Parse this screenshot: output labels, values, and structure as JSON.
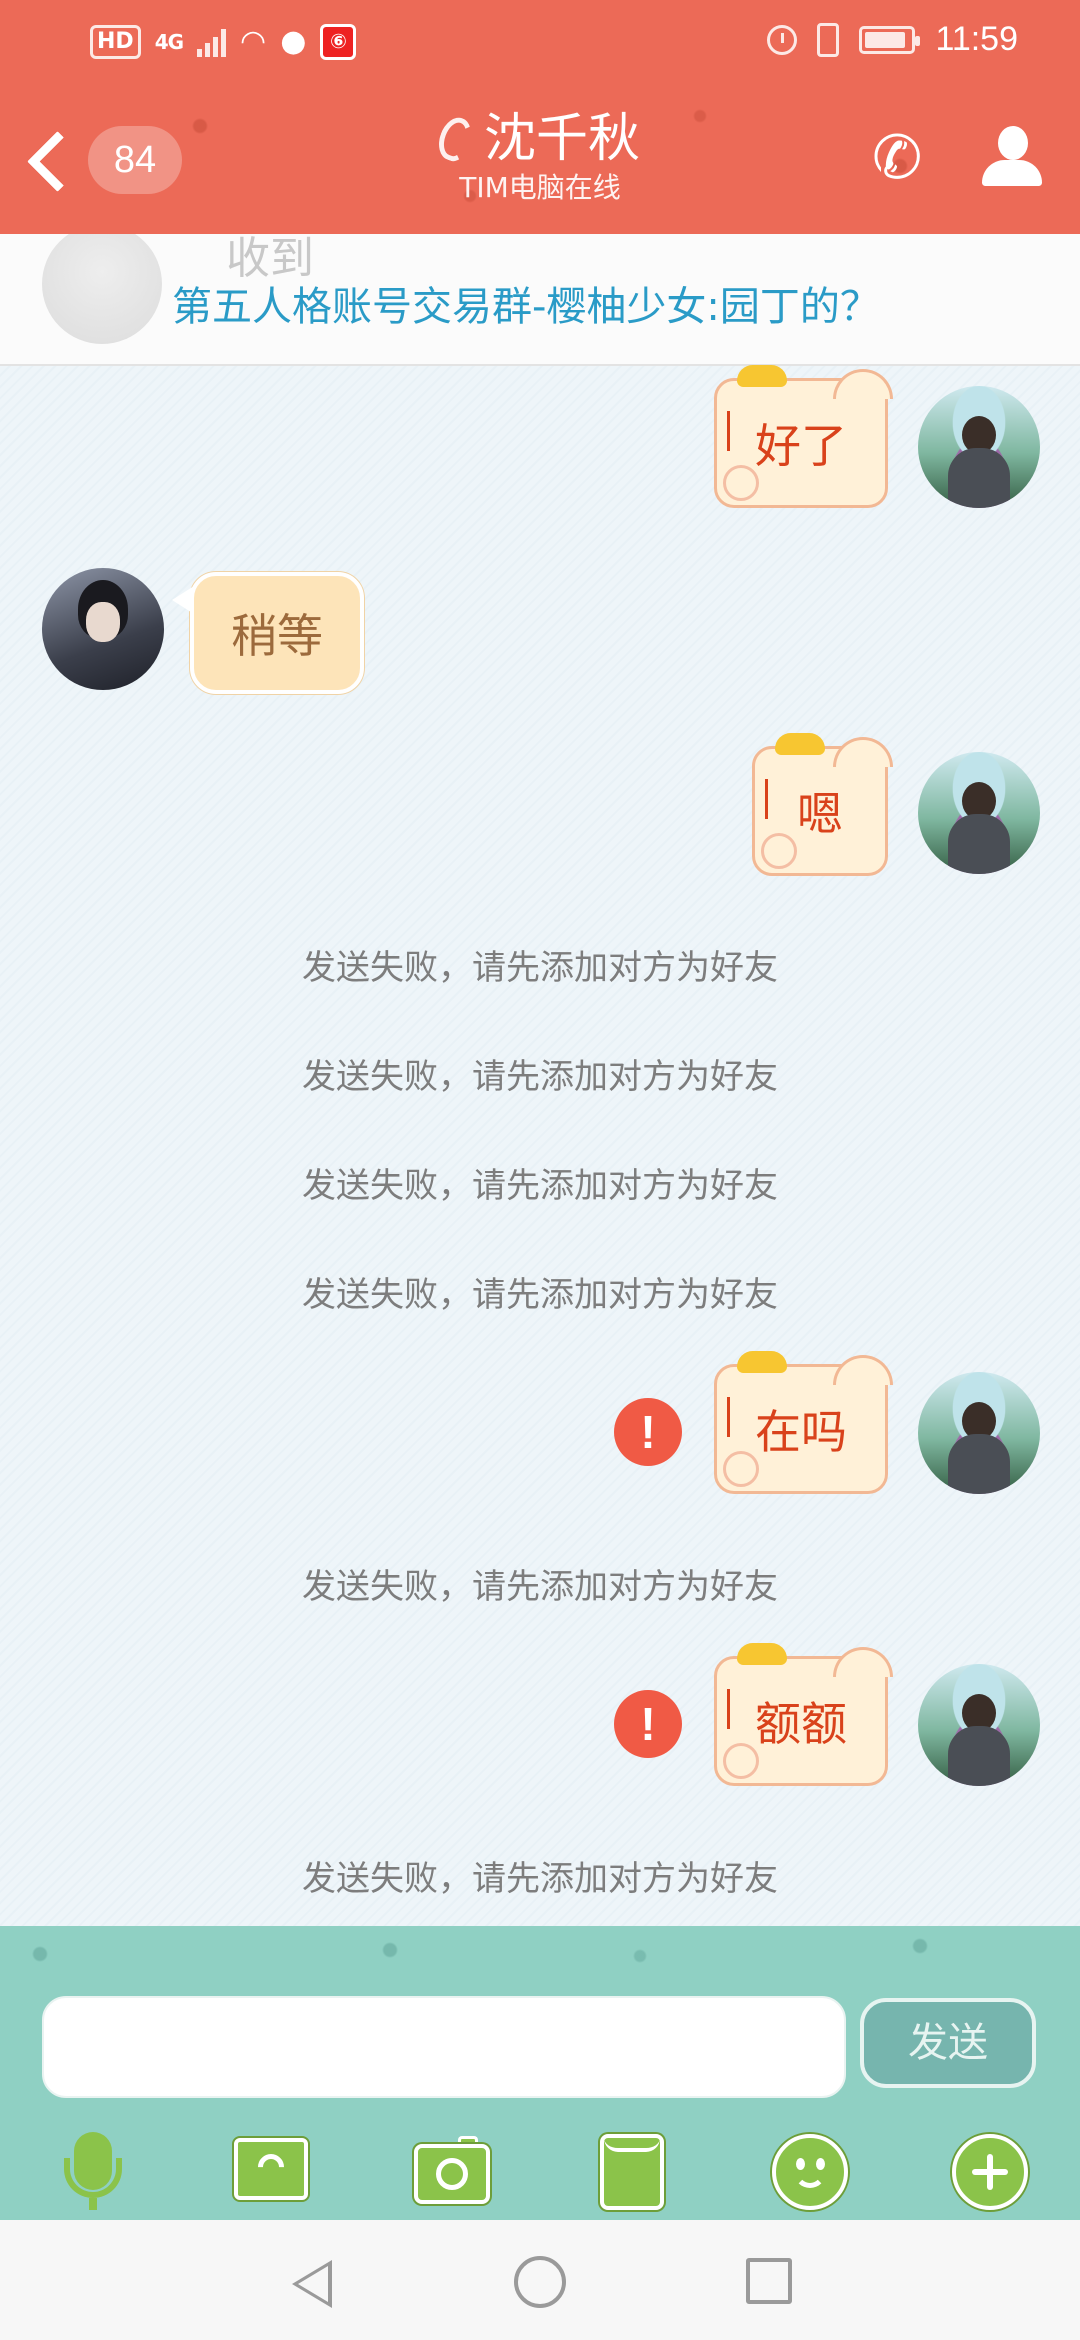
{
  "status_bar": {
    "hd_label": "HD",
    "network_label": "4G",
    "app_badge": "⑥",
    "time": "11:59",
    "battery_level": 0.9
  },
  "header": {
    "unread_count": "84",
    "title": "沈千秋",
    "subtitle": "TIM电脑在线",
    "icons": [
      "back-arrow-icon",
      "ear-icon",
      "phone-icon",
      "contact-icon"
    ]
  },
  "banner": {
    "ghost_text": "收到",
    "text": "第五人格账号交易群-樱柚少女:园丁的？"
  },
  "messages": [
    {
      "from": "me",
      "text": "好了",
      "failed": false
    },
    {
      "from": "other",
      "text": "稍等"
    },
    {
      "from": "me",
      "text": "嗯",
      "failed": false
    },
    {
      "from": "system",
      "text": "发送失败，请先添加对方为好友"
    },
    {
      "from": "system",
      "text": "发送失败，请先添加对方为好友"
    },
    {
      "from": "system",
      "text": "发送失败，请先添加对方为好友"
    },
    {
      "from": "system",
      "text": "发送失败，请先添加对方为好友"
    },
    {
      "from": "me",
      "text": "在吗",
      "failed": true
    },
    {
      "from": "system",
      "text": "发送失败，请先添加对方为好友"
    },
    {
      "from": "me",
      "text": "额额",
      "failed": true
    },
    {
      "from": "system",
      "text": "发送失败，请先添加对方为好友"
    }
  ],
  "fail_icon_glyph": "!",
  "input": {
    "value": "",
    "placeholder": "",
    "send_label": "发送"
  },
  "toolbar": [
    "microphone-icon",
    "photo-icon",
    "camera-icon",
    "file-icon",
    "emoji-icon",
    "plus-icon"
  ],
  "colors": {
    "header": "#ec6a57",
    "input_area": "#8fd0c3",
    "banner_link": "#2a9bc7",
    "fail": "#f05a45"
  }
}
